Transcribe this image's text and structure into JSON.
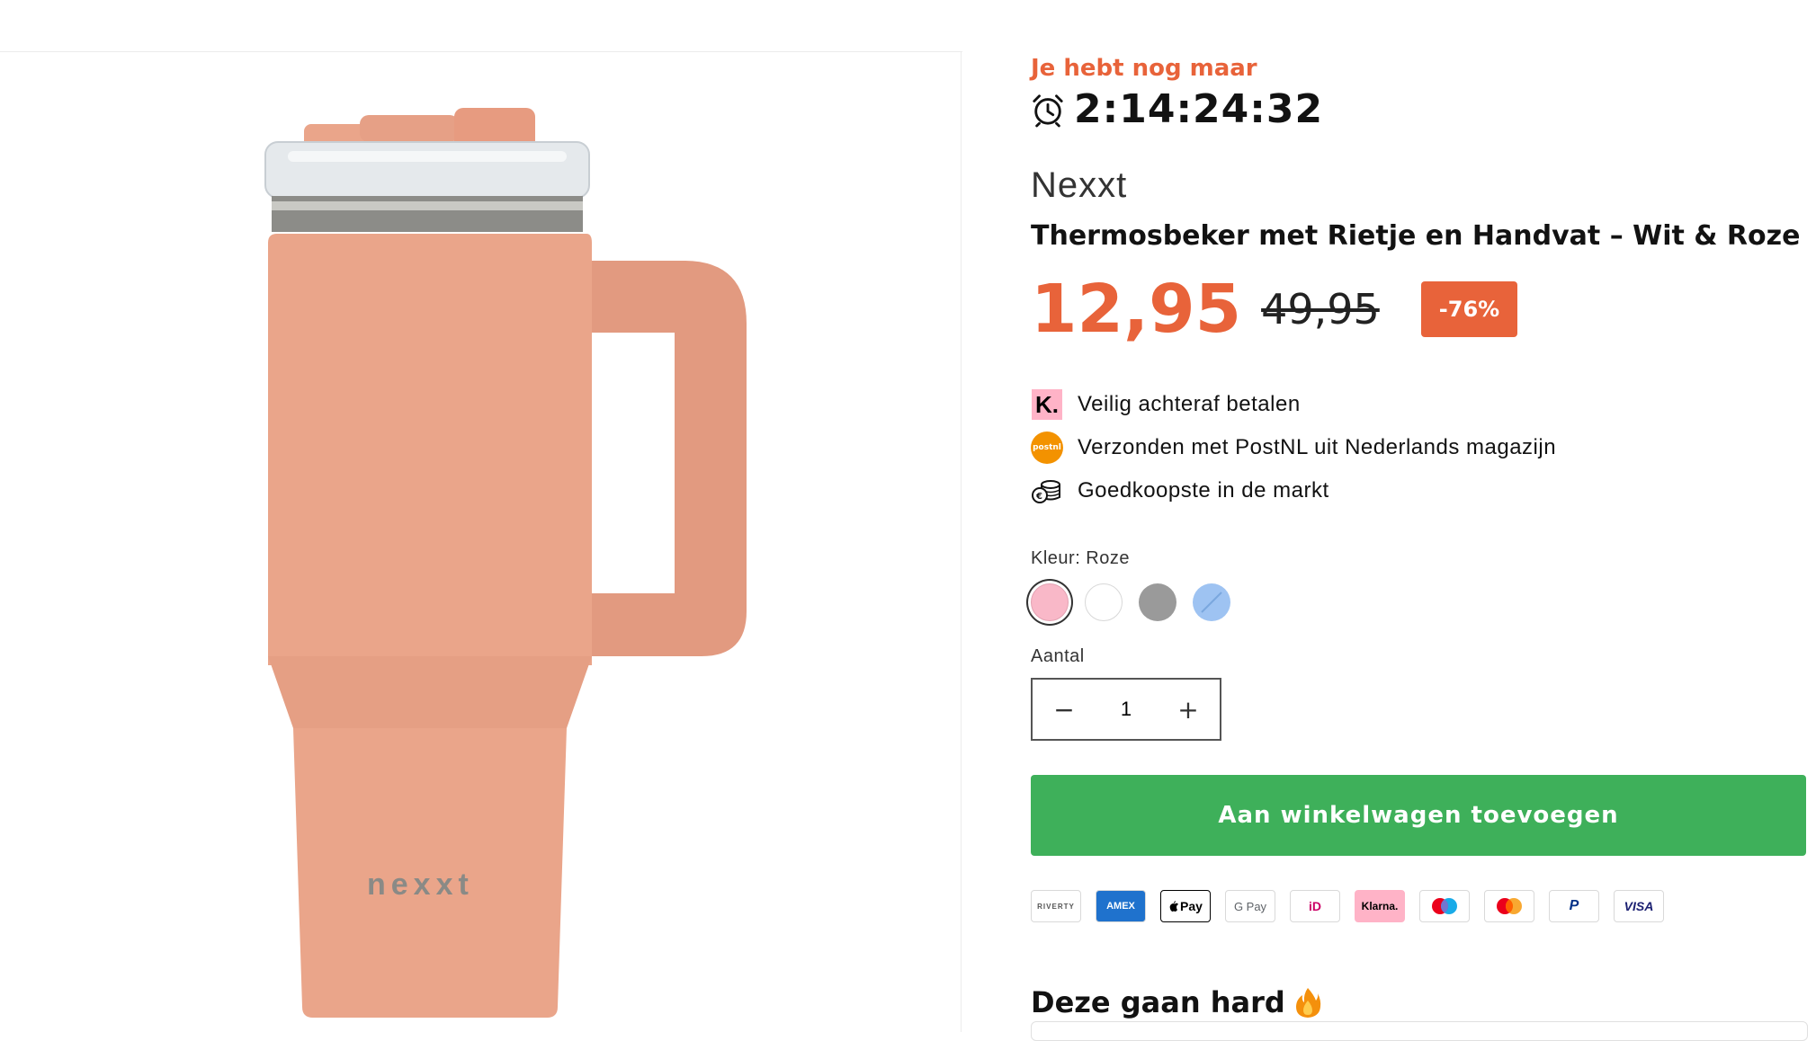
{
  "countdown": {
    "label": "Je hebt nog maar",
    "value": "2:14:24:32",
    "icon": "alarm-clock-icon"
  },
  "product": {
    "vendor": "Nexxt",
    "title": "Thermosbeker met Rietje en Handvat – Wit & Roze",
    "price": "12,95",
    "compare_price": "49,95",
    "discount": "-76%",
    "image_brand_mark": "nexxt",
    "colors": {
      "body": "#eaa58a",
      "handle": "#e29a80",
      "accent": "#e8633a"
    }
  },
  "usps": [
    {
      "icon": "klarna-k-icon",
      "icon_text": "K.",
      "text": "Veilig achteraf betalen"
    },
    {
      "icon": "postnl-icon",
      "icon_text": "postnl",
      "text": "Verzonden met PostNL uit Nederlands magazijn"
    },
    {
      "icon": "coins-icon",
      "text": "Goedkoopste in de markt"
    }
  ],
  "variant": {
    "label": "Kleur: Roze",
    "swatches": [
      {
        "name": "Roze",
        "color": "#f9b8c8",
        "selected": true
      },
      {
        "name": "Wit",
        "color": "#ffffff",
        "selected": false
      },
      {
        "name": "Grijs",
        "color": "#9a9a9a",
        "selected": false
      },
      {
        "name": "Blauw",
        "color": "#9ec3f2",
        "selected": false,
        "unavailable": true
      }
    ]
  },
  "quantity": {
    "label": "Aantal",
    "value": "1",
    "minus": "−",
    "plus": "+"
  },
  "add_to_cart": {
    "label": "Aan winkelwagen toevoegen",
    "color": "#3eb05a"
  },
  "payment_methods": [
    {
      "name": "Riverty",
      "text": "RIVERTY"
    },
    {
      "name": "American Express",
      "text": "AMEX"
    },
    {
      "name": "Apple Pay",
      "text": "Pay"
    },
    {
      "name": "Google Pay",
      "text": "G Pay"
    },
    {
      "name": "iDEAL",
      "text": "iD"
    },
    {
      "name": "Klarna",
      "text": "Klarna."
    },
    {
      "name": "Maestro",
      "text": ""
    },
    {
      "name": "Mastercard",
      "text": ""
    },
    {
      "name": "PayPal",
      "text": "P"
    },
    {
      "name": "Visa",
      "text": "VISA"
    }
  ],
  "related": {
    "title": "Deze gaan hard",
    "icon": "fire-icon"
  }
}
